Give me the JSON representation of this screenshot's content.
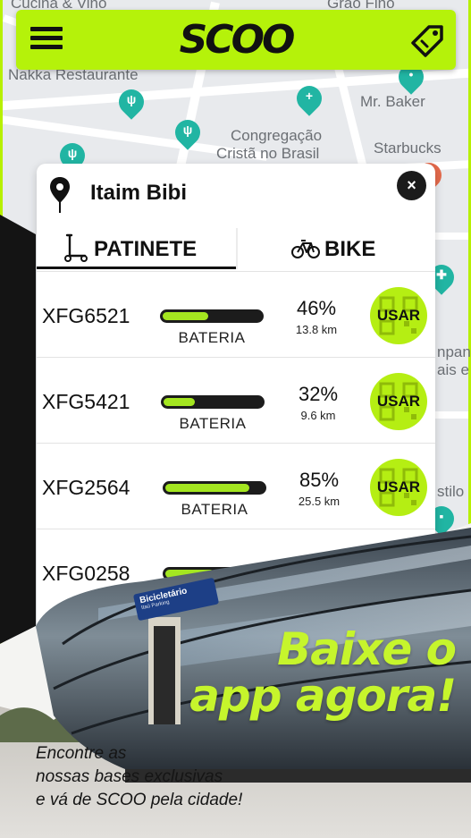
{
  "header": {
    "logo": "SCOO",
    "menu_icon": "hamburger-menu-icon",
    "tag_icon": "price-tag-icon",
    "accent": "#b5f20a"
  },
  "map": {
    "labels": {
      "cucina": "Cucina & Vino",
      "grao": "Grão Fino",
      "nakka": "Nakka Restaurante",
      "baker": "Mr. Baker",
      "congregacao_1": "Congregação",
      "congregacao_2": "Cristã no Brasil",
      "starbucks": "Starbucks",
      "edge_a": "npan",
      "edge_b": "ais e",
      "edge_c": "stilo"
    }
  },
  "card": {
    "location": "Itaim Bibi",
    "close": "×",
    "tabs": [
      {
        "label": "PATINETE",
        "icon": "scooter-icon",
        "active": true
      },
      {
        "label": "BIKE",
        "icon": "bicycle-icon",
        "active": false
      }
    ],
    "battery_label": "BATERIA",
    "action_label": "USAR",
    "vehicles": [
      {
        "code": "XFG6521",
        "battery_pct": "46%",
        "battery_fraction": 0.46,
        "range": "13.8 km"
      },
      {
        "code": "XFG5421",
        "battery_pct": "32%",
        "battery_fraction": 0.32,
        "range": "9.6 km"
      },
      {
        "code": "XFG2564",
        "battery_pct": "85%",
        "battery_fraction": 0.85,
        "range": "25.5 km"
      },
      {
        "code": "XFG0258",
        "battery_pct": "",
        "battery_fraction": 0.5,
        "range": ""
      }
    ]
  },
  "promo": {
    "headline_1": "Baixe o",
    "headline_2": "app agora!",
    "tagline_1": "Encontre as",
    "tagline_2": "nossas bases exclusivas",
    "tagline_3": "e vá de SCOO pela cidade!",
    "sign_title": "Bicicletário",
    "sign_sub": "Itaú Parking",
    "headline_color": "#c6f52c"
  }
}
